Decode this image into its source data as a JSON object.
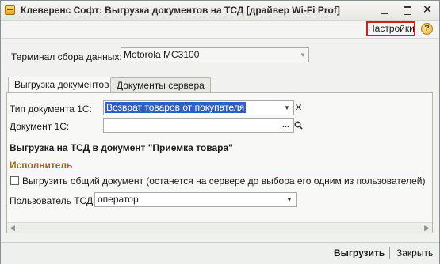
{
  "window": {
    "title": "Клеверенс Софт: Выгрузка документов на ТСД [драйвер Wi-Fi Prof]",
    "min_label": "",
    "max_label": "",
    "close_label": "✕"
  },
  "header": {
    "settings_label": "Настройки",
    "help_label": "?"
  },
  "terminal": {
    "label": "Терминал сбора данных:",
    "value": "Motorola MC3100"
  },
  "tabs": [
    {
      "label": "Выгрузка документов",
      "active": true
    },
    {
      "label": "Документы сервера",
      "active": false
    }
  ],
  "doc_type": {
    "label": "Тип документа 1С:",
    "value": "Возврат товаров от покупателя"
  },
  "document": {
    "label": "Документ 1С:",
    "value": ""
  },
  "section": {
    "title": "Выгрузка на ТСД в документ \"Приемка товара\""
  },
  "executor": {
    "group_title": "Исполнитель",
    "checkbox_label": "Выгрузить общий документ (останется на сервере до выбора его одним из пользователей)",
    "checkbox_checked": false,
    "user_label": "Пользователь ТСД:",
    "user_value": "оператор"
  },
  "footer": {
    "upload_label": "Выгрузить",
    "close_label": "Закрыть"
  },
  "colors": {
    "highlight_border": "#d11f1f",
    "selection": "#2f5fc6",
    "group_title": "#9a6a14"
  }
}
